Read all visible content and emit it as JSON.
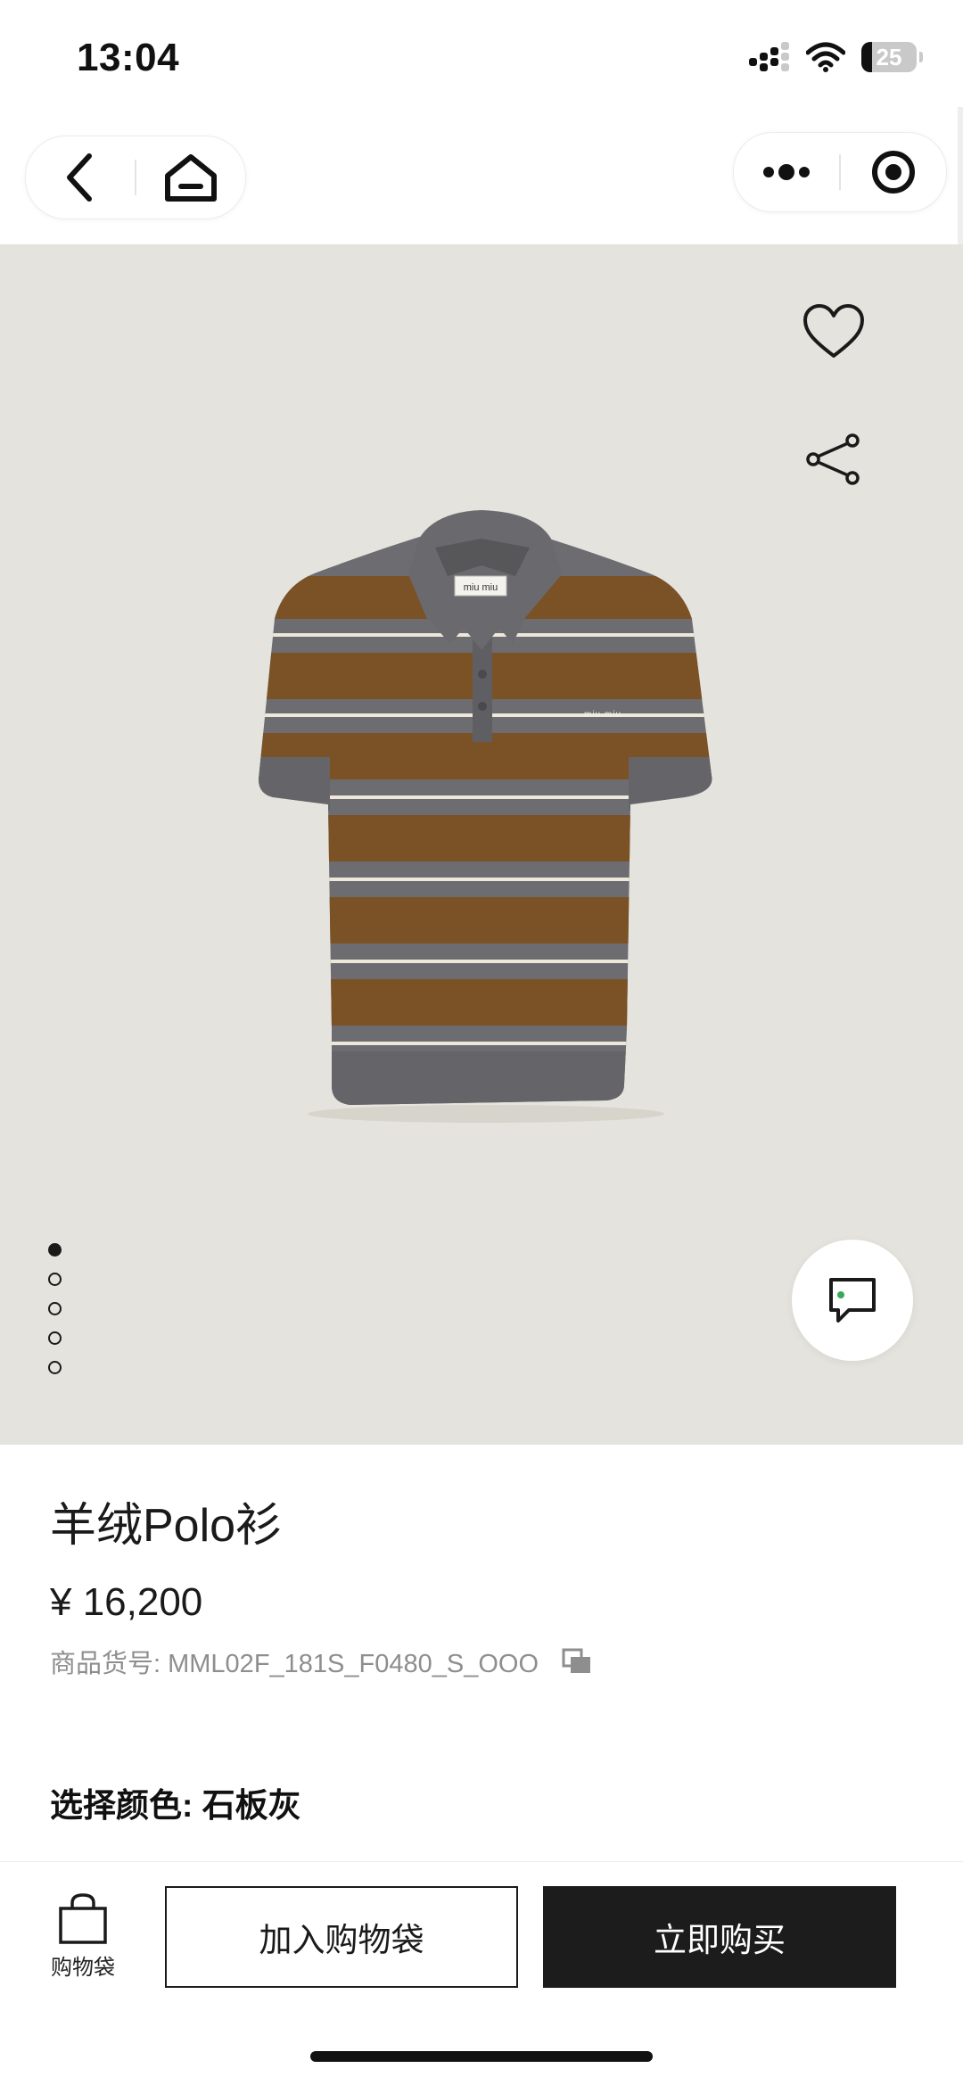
{
  "status_bar": {
    "time": "13:04",
    "battery": "25"
  },
  "nav": {
    "back_icon": "chevron-left-icon",
    "home_icon": "home-icon",
    "more_icon": "more-dots-icon",
    "close_icon": "target-icon"
  },
  "gallery": {
    "image_count": 5,
    "active_index": 0,
    "favorite_icon": "heart-icon",
    "share_icon": "share-icon",
    "chat_icon": "chat-icon",
    "label_text": "miu miu"
  },
  "product": {
    "title": "羊绒Polo衫",
    "price": "¥ 16,200",
    "sku": "商品货号: MML02F_181S_F0480_S_OOO",
    "copy_icon": "copy-icon",
    "color_label": "选择颜色: 石板灰"
  },
  "bottom_bar": {
    "bag_label": "购物袋",
    "add_to_bag": "加入购物袋",
    "buy_now": "立即购买"
  },
  "colors": {
    "hero_bg": "#e5e3dd",
    "dark_button": "#1c1c1c",
    "stripe_brown": "#7a5125",
    "knit_grey": "#6e6e72"
  }
}
